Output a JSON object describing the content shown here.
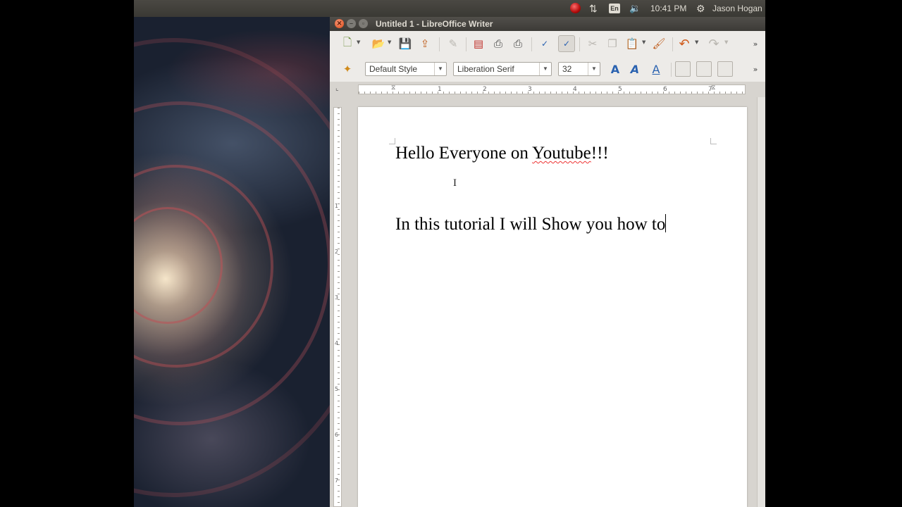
{
  "panel": {
    "clock": "10:41 PM",
    "user": "Jason Hogan",
    "keyboard_layout": "En",
    "icons": [
      "ruby-indicator-icon",
      "network-icon",
      "keyboard-icon",
      "volume-icon",
      "gear-icon"
    ]
  },
  "window": {
    "title": "Untitled 1 - LibreOffice Writer",
    "controls": [
      "close-icon",
      "minimize-icon",
      "maximize-icon"
    ]
  },
  "format_toolbar": {
    "paragraph_style": "Default Style",
    "font_name": "Liberation Serif",
    "font_size": "32"
  },
  "ruler": {
    "labels": [
      "1",
      "2",
      "3",
      "4",
      "5",
      "6",
      "7"
    ],
    "vertical_labels": [
      "1",
      "2",
      "3",
      "4",
      "5",
      "6",
      "7"
    ]
  },
  "document": {
    "paragraph_1_prefix": "Hello Everyone on ",
    "paragraph_1_misspelled": "Youtube",
    "paragraph_1_suffix": "!!!",
    "paragraph_2": "In this tutorial I will Show you how to"
  },
  "colors": {
    "panel_bg": "#3c3b37",
    "toolbar_bg": "#edebe8",
    "close_button": "#df4a16",
    "spellcheck_underline": "#ee3333"
  }
}
